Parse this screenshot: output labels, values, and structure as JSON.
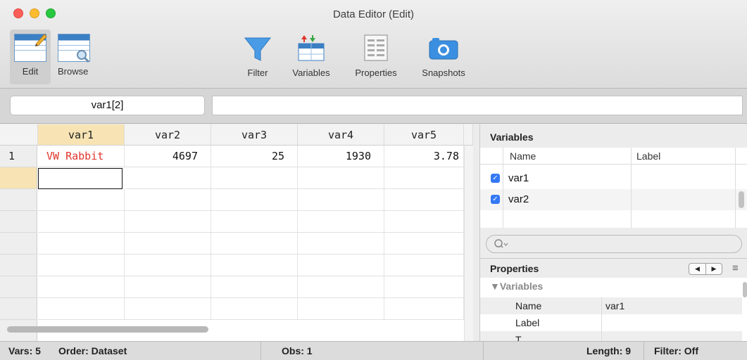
{
  "window": {
    "title": "Data Editor (Edit)"
  },
  "toolbar": {
    "edit_label": "Edit",
    "browse_label": "Browse",
    "filter_label": "Filter",
    "variables_label": "Variables",
    "properties_label": "Properties",
    "snapshots_label": "Snapshots"
  },
  "fieldbar": {
    "cell_reference": "var1[2]",
    "cell_value": ""
  },
  "grid": {
    "columns": [
      "var1",
      "var2",
      "var3",
      "var4",
      "var5"
    ],
    "rows": [
      {
        "index": "1",
        "cells": [
          "VW Rabbit",
          "4697",
          "25",
          "1930",
          "3.78"
        ]
      }
    ],
    "selected_cell": {
      "row": 2,
      "column": "var1"
    }
  },
  "variables_panel": {
    "title": "Variables",
    "col_name": "Name",
    "col_label": "Label",
    "items": [
      {
        "name": "var1",
        "label": "",
        "checked": true
      },
      {
        "name": "var2",
        "label": "",
        "checked": true
      }
    ],
    "search_placeholder": ""
  },
  "properties_panel": {
    "title": "Properties",
    "group_label": "▼Variables",
    "rows": [
      {
        "key": "Name",
        "value": "var1"
      },
      {
        "key": "Label",
        "value": ""
      },
      {
        "key": "T",
        "value": ""
      }
    ]
  },
  "status": {
    "vars": "Vars: 5",
    "order": "Order: Dataset",
    "obs": "Obs: 1",
    "length": "Length: 9",
    "filter": "Filter: Off"
  },
  "colors": {
    "accent": "#3478f6",
    "string_value": "#e0362c",
    "active_header": "#f7e3b4"
  }
}
